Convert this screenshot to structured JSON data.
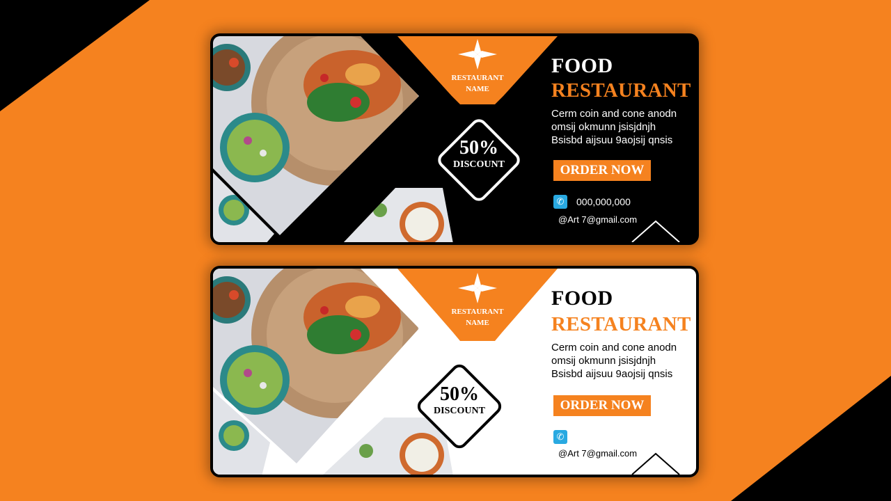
{
  "banners": [
    {
      "theme": "dark",
      "logo_line1": "RESTAURANT",
      "logo_line2": "NAME",
      "discount_percent": "50%",
      "discount_label": "DISCOUNT",
      "title_line1": "FOOD",
      "title_line2": "RESTAURANT",
      "description": [
        "Cerm coin and cone anodn",
        " omsij okmunn jsisjdnjh",
        "Bsisbd aijsuu 9aojsij qnsis"
      ],
      "order_button": "ORDER NOW",
      "phone_icon": "phone-icon",
      "phone": "000,000,000",
      "email": "@Art 7@gmail.com"
    },
    {
      "theme": "light",
      "logo_line1": "RESTAURANT",
      "logo_line2": "NAME",
      "discount_percent": "50%",
      "discount_label": "DISCOUNT",
      "title_line1": "FOOD",
      "title_line2": "RESTAURANT",
      "description": [
        "Cerm coin and cone anodn",
        " omsij okmunn jsisjdnjh",
        "Bsisbd aijsuu 9aojsij qnsis"
      ],
      "order_button": "ORDER NOW",
      "phone_icon": "phone-icon",
      "email": "@Art 7@gmail.com"
    }
  ],
  "colors": {
    "background": "#f5821f",
    "accent": "#f5821f",
    "dark": "#000000",
    "light": "#ffffff",
    "phone_icon": "#29a9e1"
  }
}
